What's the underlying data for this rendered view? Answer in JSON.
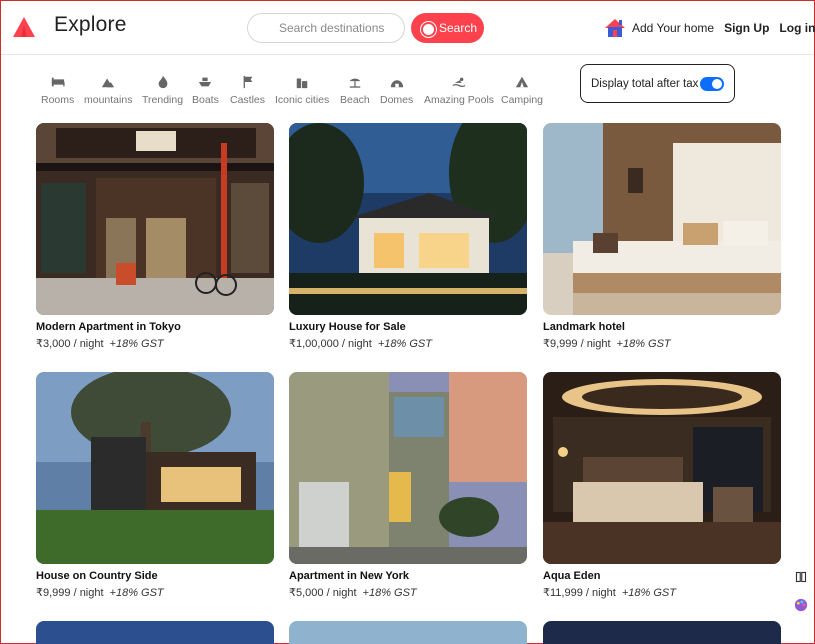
{
  "brand": {
    "title": "Explore",
    "logo_icon": "compass-triangle-icon",
    "color": "#fe424d"
  },
  "search": {
    "placeholder": "Search destinations",
    "button_label": "Search",
    "button_color": "#fe424d"
  },
  "nav": {
    "add_home": "Add Your home",
    "sign_up": "Sign Up",
    "log_in": "Log in"
  },
  "filters": [
    {
      "label": "Rooms",
      "icon": "bed-icon"
    },
    {
      "label": "mountains",
      "icon": "mountain-icon"
    },
    {
      "label": "Trending",
      "icon": "fire-icon"
    },
    {
      "label": "Boats",
      "icon": "ship-icon"
    },
    {
      "label": "Castles",
      "icon": "flag-icon"
    },
    {
      "label": "Iconic cities",
      "icon": "city-icon"
    },
    {
      "label": "Beach",
      "icon": "umbrella-beach-icon"
    },
    {
      "label": "Domes",
      "icon": "igloo-icon"
    },
    {
      "label": "Amazing Pools",
      "icon": "swimmer-icon"
    },
    {
      "label": "Camping",
      "icon": "campground-icon"
    }
  ],
  "tax_toggle": {
    "label": "Display total after tax",
    "enabled": true,
    "color": "#0d6efd"
  },
  "listings": [
    {
      "title": "Modern Apartment in Tokyo",
      "price": "₹3,000 / night",
      "tax": "+18% GST"
    },
    {
      "title": "Luxury House for Sale",
      "price": "₹1,00,000 / night",
      "tax": "+18% GST"
    },
    {
      "title": "Landmark hotel",
      "price": "₹9,999 / night",
      "tax": "+18% GST"
    },
    {
      "title": "House on Country Side",
      "price": "₹9,999 / night",
      "tax": "+18% GST"
    },
    {
      "title": "Apartment in New York",
      "price": "₹5,000 / night",
      "tax": "+18% GST"
    },
    {
      "title": "Aqua Eden",
      "price": "₹11,999 / night",
      "tax": "+18% GST"
    }
  ],
  "side_tools": [
    "book-icon",
    "palette-icon"
  ]
}
